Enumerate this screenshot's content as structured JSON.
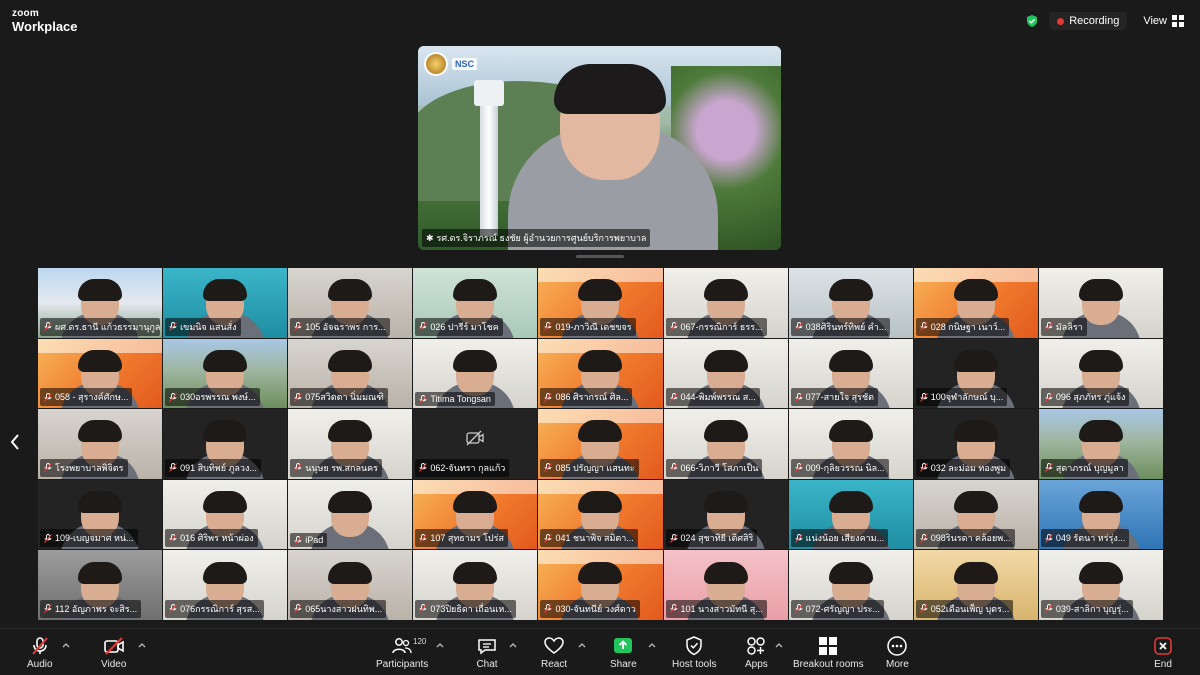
{
  "app": {
    "brand_line1": "zoom",
    "brand_line2": "Workplace"
  },
  "header": {
    "recording_label": "Recording",
    "view_label": "View",
    "colors": {
      "recording_dot": "#e53935",
      "shield": "#21c45d"
    }
  },
  "speaker": {
    "name": "รศ.ดร.จิราภรณ์ ธงชัย ผู้อำนวยการศูนย์บริการพยาบาล",
    "logo_text": "NSC"
  },
  "participants": [
    {
      "name": "ผศ.ดร.ธานี แก้วธรรมานุกูล",
      "bg": "bg-building"
    },
    {
      "name": "เขมนิจ แสนสั่ง",
      "bg": "bg-teal"
    },
    {
      "name": "105 อัจฉราพร การ...",
      "bg": "bg-room"
    },
    {
      "name": "026 ปารีร์ มาโชค",
      "bg": "bg-green"
    },
    {
      "name": "019-ภาวิณี เดชขจร",
      "bg": "bg-orange"
    },
    {
      "name": "067-กรรณิการ์ ธรร...",
      "bg": "bg-light"
    },
    {
      "name": "038ศิรินทร์ทิพย์ คำ...",
      "bg": "bg-screen"
    },
    {
      "name": "028 กนิษฐา เนาว์...",
      "bg": "bg-orange"
    },
    {
      "name": "มัลลิรา",
      "bg": "bg-light"
    },
    {
      "name": "058 - สุรางค์ศักษ...",
      "bg": "bg-orange"
    },
    {
      "name": "030อรพรรณ พงษ์...",
      "bg": "bg-outdoor"
    },
    {
      "name": "075สวิตตา นิ่มมณฑิ",
      "bg": "bg-room"
    },
    {
      "name": "Titima Tongsan",
      "bg": "bg-light"
    },
    {
      "name": "086 ศิรากรณ์ ศิล...",
      "bg": "bg-orange"
    },
    {
      "name": "044-พิมพ์พรรณ ส...",
      "bg": "bg-light"
    },
    {
      "name": "077-สายใจ สุรชัต",
      "bg": "bg-light"
    },
    {
      "name": "100จุฬาลักษณ์ บุ...",
      "bg": "bg-dark"
    },
    {
      "name": "096 สุภภัทร ภู่แจ้ง",
      "bg": "bg-light"
    },
    {
      "name": "โรงพยาบาลพิจิตร",
      "bg": "bg-room"
    },
    {
      "name": "091 สิบทิพย์ ภูลวง...",
      "bg": "bg-dark"
    },
    {
      "name": "นนุษย รพ.สกลนคร",
      "bg": "bg-light"
    },
    {
      "name": "062-จันทรา กุลแก้ว",
      "bg": "bg-dark",
      "camera_off": true
    },
    {
      "name": "085 ปรัญญา แสนทะ",
      "bg": "bg-orange"
    },
    {
      "name": "066-วิภาวี โสภาเป็น",
      "bg": "bg-light"
    },
    {
      "name": "009-กุลิยวรรณ นิล...",
      "bg": "bg-light"
    },
    {
      "name": "032 ละม่อม ทองพูม",
      "bg": "bg-dark"
    },
    {
      "name": "สุดาภรณ์ บุญมูลา",
      "bg": "bg-outdoor"
    },
    {
      "name": "109-เบญจมาศ หน่...",
      "bg": "bg-dark"
    },
    {
      "name": "016 ศิริพร หน้าผ่อง",
      "bg": "bg-light"
    },
    {
      "name": "iPad",
      "bg": "bg-light"
    },
    {
      "name": "107 สุทธามร โปร่ส",
      "bg": "bg-orange"
    },
    {
      "name": "041 ชนาพิจ สมิตา...",
      "bg": "bg-orange"
    },
    {
      "name": "024 สุชาทิยี เติศสิริ",
      "bg": "bg-dark"
    },
    {
      "name": "แน่งน้อย เสียงคาม...",
      "bg": "bg-teal"
    },
    {
      "name": "098รินรดา คล้อยพ...",
      "bg": "bg-room"
    },
    {
      "name": "049 รัตนา หร่รุ่ง...",
      "bg": "bg-blue"
    },
    {
      "name": "112 อัญภาพร จะสิร...",
      "bg": "bg-gray"
    },
    {
      "name": "076กรรณิการ์ สุรส...",
      "bg": "bg-light"
    },
    {
      "name": "065นางสาวฝนทิพ...",
      "bg": "bg-room"
    },
    {
      "name": "073ปิยธิดา เถื่อนเห...",
      "bg": "bg-light"
    },
    {
      "name": "030-จันทนีย์ วงศ์ดาว",
      "bg": "bg-orange"
    },
    {
      "name": "101 นางสาวมัทนี สุ...",
      "bg": "bg-pink"
    },
    {
      "name": "072-ศรัญญา ประ...",
      "bg": "bg-light"
    },
    {
      "name": "052เดือนเพ็ญ บุตร...",
      "bg": "bg-yellow"
    },
    {
      "name": "039-สาลิกา บุญรุ่...",
      "bg": "bg-light"
    }
  ],
  "toolbar": {
    "audio": "Audio",
    "video": "Video",
    "participants": "Participants",
    "participant_count": "120",
    "chat": "Chat",
    "react": "React",
    "share": "Share",
    "host_tools": "Host tools",
    "apps": "Apps",
    "breakout": "Breakout rooms",
    "more": "More",
    "end": "End",
    "colors": {
      "share": "#21c45d",
      "end": "#e53935",
      "muted": "#e53935"
    }
  }
}
